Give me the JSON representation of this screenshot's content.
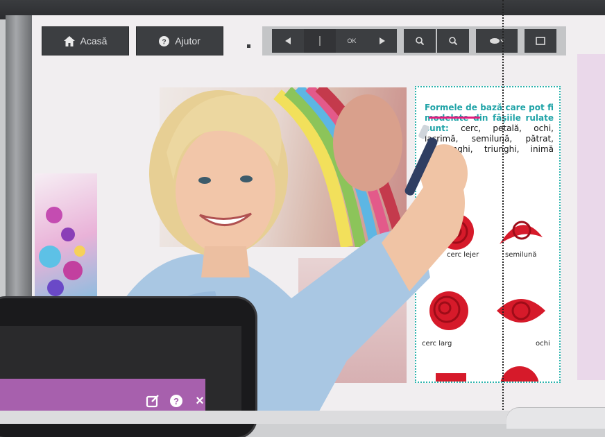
{
  "toolbar": {
    "home_label": "Acasă",
    "help_label": "Ajutor",
    "page_field": "OK",
    "icons": [
      "home-icon",
      "help-icon",
      "prev-icon",
      "page-input",
      "next-icon",
      "zoom-in-icon",
      "zoom-out-icon",
      "view-options-icon",
      "fullscreen-icon"
    ]
  },
  "textbox": {
    "heading_bold": "Formele de bază care pot fi modelate din fâșiile rulate sunt:",
    "heading_rest": " cerc, petală, ochi, lacrimă, semilună, pătrat, dreptunghi, triunghi, inimă etc.",
    "shapes": [
      {
        "caption": "cerc lejer"
      },
      {
        "caption": "semilună"
      },
      {
        "caption": "cerc larg"
      },
      {
        "caption": "ochi"
      }
    ]
  },
  "tablet_toolbar": {
    "icons": [
      "edit-icon",
      "help-icon",
      "close-icon"
    ],
    "close_glyph": "×"
  },
  "colors": {
    "accent_teal": "#1fa3a7",
    "marker_pink": "#e21c7d",
    "tablet_purple": "#a760ad",
    "panel_pink": "#ead8ea"
  }
}
